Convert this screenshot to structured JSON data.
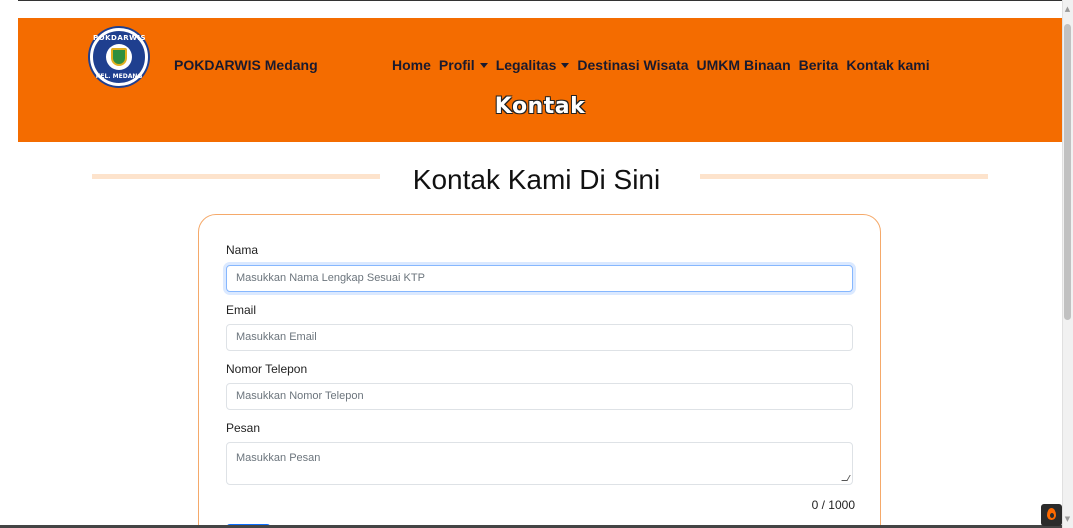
{
  "header": {
    "brand": "POKDARWIS Medang",
    "logo_text_top": "POKDARWIS",
    "logo_text_bottom": "KEL. MEDANG",
    "nav": [
      {
        "label": "Home",
        "dropdown": false
      },
      {
        "label": "Profil",
        "dropdown": true
      },
      {
        "label": "Legalitas",
        "dropdown": true
      },
      {
        "label": "Destinasi Wisata",
        "dropdown": false
      },
      {
        "label": "UMKM Binaan",
        "dropdown": false
      },
      {
        "label": "Berita",
        "dropdown": false
      },
      {
        "label": "Kontak kami",
        "dropdown": false
      }
    ],
    "page_heading": "Kontak",
    "bg_color": "#f46c00"
  },
  "section": {
    "title": "Kontak Kami Di Sini"
  },
  "form": {
    "name_label": "Nama",
    "name_placeholder": "Masukkan Nama Lengkap Sesuai KTP",
    "email_label": "Email",
    "email_placeholder": "Masukkan Email",
    "phone_label": "Nomor Telepon",
    "phone_placeholder": "Masukkan Nomor Telepon",
    "message_label": "Pesan",
    "message_placeholder": "Masukkan Pesan",
    "char_counter": "0 / 1000",
    "submit_color": "#0d6efd"
  }
}
